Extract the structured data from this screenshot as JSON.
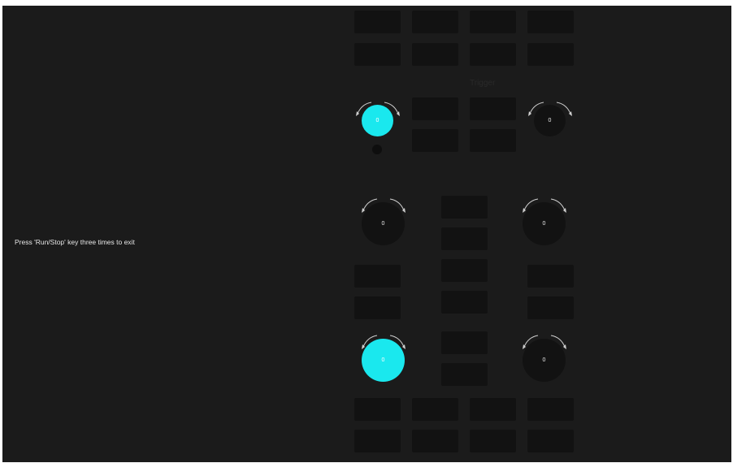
{
  "screen": {
    "message": "Press 'Run/Stop' key three times to exit"
  },
  "panel": {
    "trigger_label": "Trigger",
    "knobs": {
      "multipurpose_a": "0",
      "trigger_level": "0",
      "ch_position_left": "0",
      "ch_position_right": "0",
      "ch_scale_left": "0",
      "ch_scale_right": "0"
    }
  },
  "colors": {
    "background": "#1b1b1b",
    "key": "#121212",
    "active_knob": "#1ae8ee"
  }
}
